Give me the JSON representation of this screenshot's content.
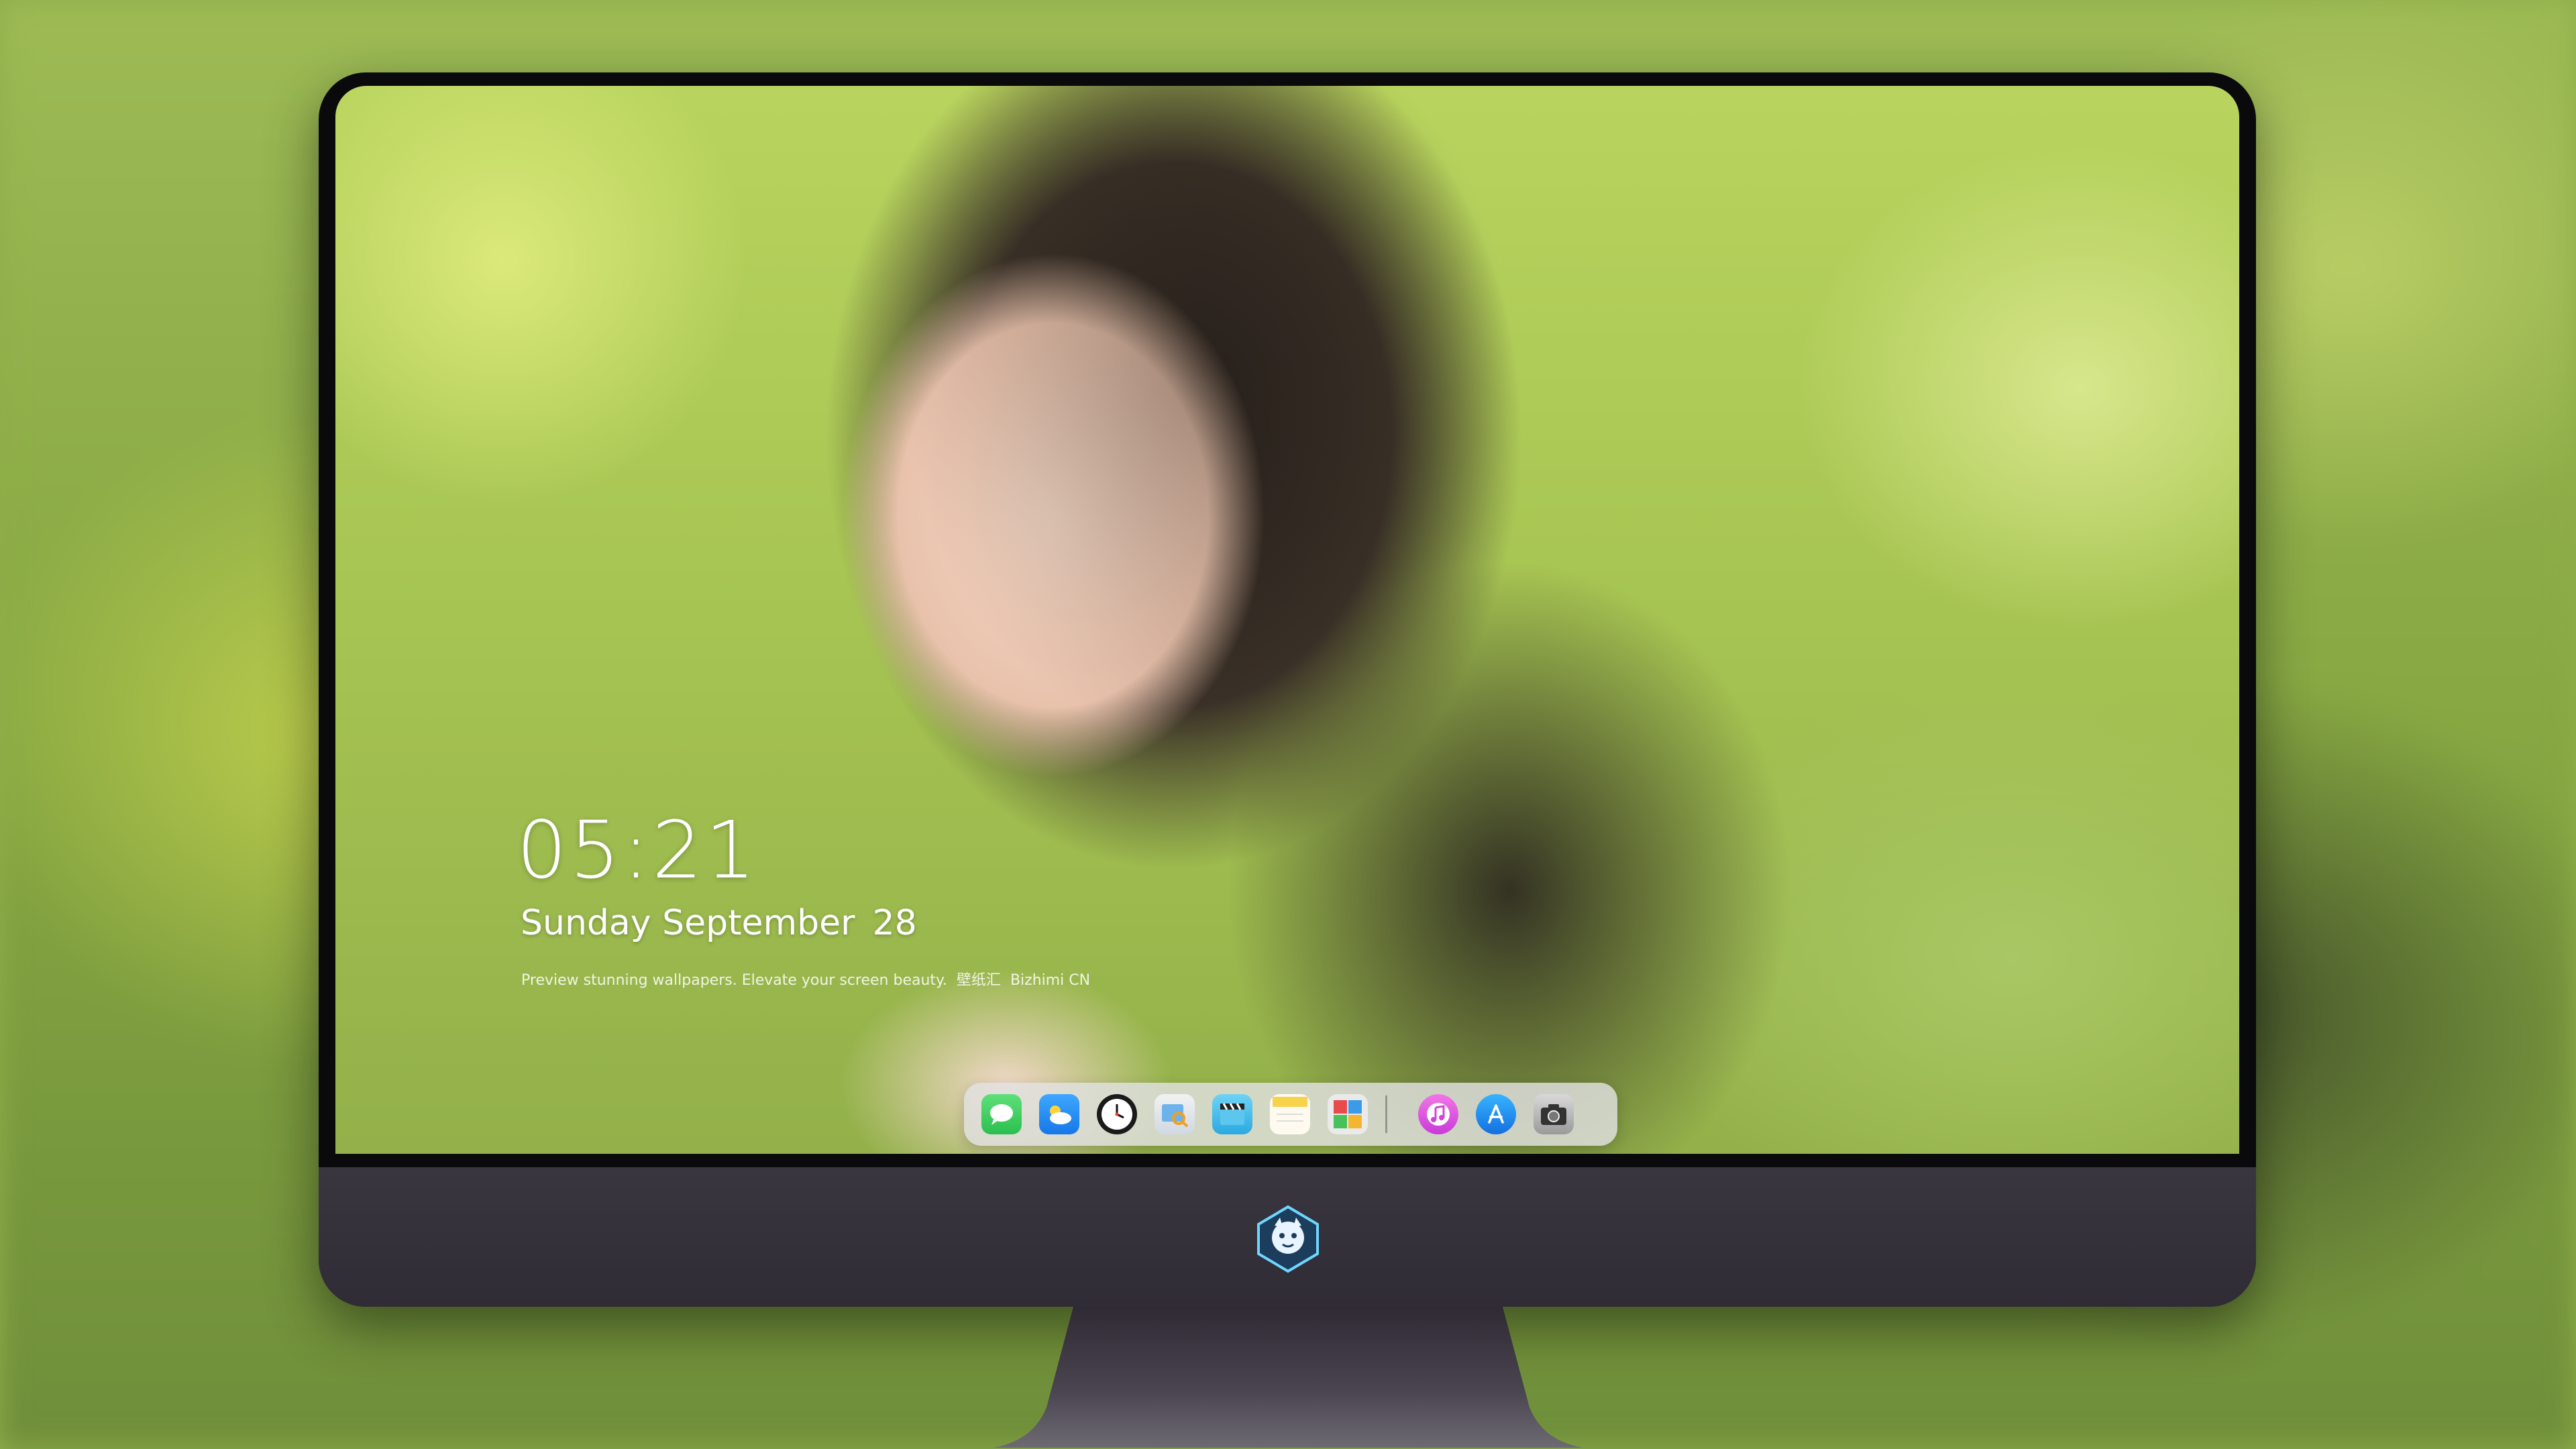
{
  "lockscreen": {
    "time": "05:21",
    "weekday_month": "Sunday September",
    "day": "28",
    "tagline": "Preview stunning wallpapers. Elevate your screen beauty.",
    "brand_cn": "壁纸汇",
    "brand_en": "Bizhimi CN"
  },
  "dock": {
    "apps": [
      {
        "name": "messages-icon",
        "color": "#34c759"
      },
      {
        "name": "weather-icon",
        "color": "#1e8ef5"
      },
      {
        "name": "clock-icon",
        "color": "#1a1a1a"
      },
      {
        "name": "preview-icon",
        "color": "#5aa9e6"
      },
      {
        "name": "clips-icon",
        "color": "#35b6e8"
      },
      {
        "name": "notes-icon",
        "color": "#f7d24b"
      },
      {
        "name": "photo-booth-icon",
        "color": "#e8e8e8"
      },
      {
        "name": "itunes-icon",
        "color": "#e052d6"
      },
      {
        "name": "app-store-icon",
        "color": "#1b8cf2"
      },
      {
        "name": "camera-icon",
        "color": "#6b6b6b"
      }
    ]
  }
}
